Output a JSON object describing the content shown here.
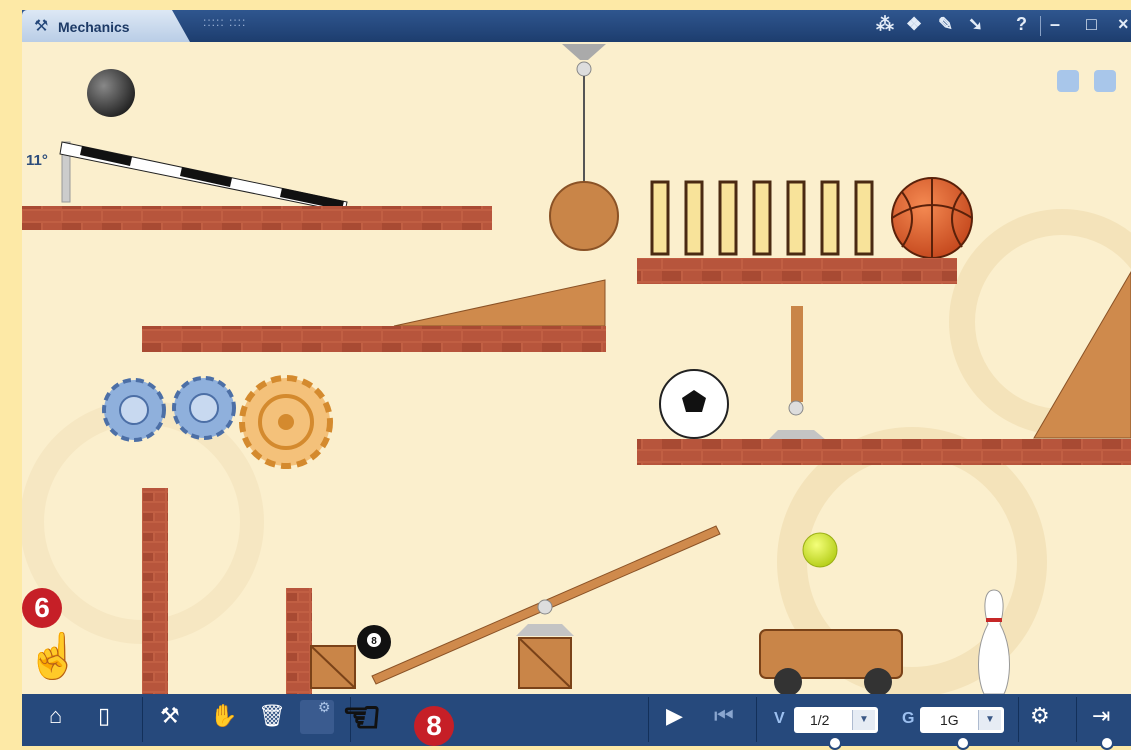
{
  "app": {
    "tab_label": "Mechanics",
    "tab_icon": "hammer-icon",
    "grip_label": "::::: ::::"
  },
  "titlebar_icons": {
    "share": "share-icon",
    "objects": "objects-icon",
    "pen": "pen-icon",
    "pointer": "pointer-icon",
    "help": "?",
    "minimize": "–",
    "maximize": "□",
    "close": "×"
  },
  "canvas": {
    "angle_readout": "11°",
    "eight_ball_label": "8"
  },
  "toolbar": {
    "home": "home-icon",
    "new_page": "new-page-icon",
    "tools": "tools-icon",
    "hand": "hand-icon",
    "trash": "trash-icon",
    "settings_small": "gear-icon",
    "play": "play-icon",
    "rewind": "rewind-icon",
    "v_label": "V",
    "v_value": "1/2",
    "g_label": "G",
    "g_value": "1G",
    "settings": "gear-icon",
    "exit": "exit-icon"
  },
  "callouts": {
    "six": "6",
    "eight": "8"
  },
  "colors": {
    "titlebar": "#1d3d6e",
    "canvas": "#fbefcd",
    "toolbar": "#26497c",
    "callout": "#c61f27",
    "brick": "#b7553c",
    "wood": "#c98548"
  }
}
